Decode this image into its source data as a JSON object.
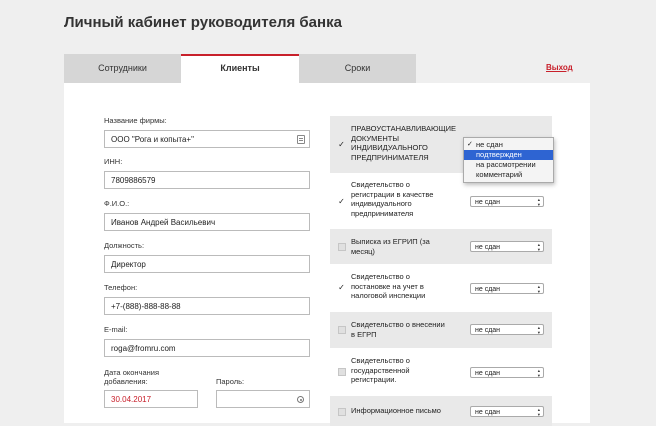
{
  "page": {
    "title": "Личный кабинет руководителя банка"
  },
  "tabs": [
    {
      "label": "Сотрудники",
      "active": false
    },
    {
      "label": "Клиенты",
      "active": true
    },
    {
      "label": "Сроки",
      "active": false
    }
  ],
  "logout_label": "Выход",
  "accent_color": "#c8202b",
  "form": {
    "company": {
      "label": "Название фирмы:",
      "value": "ООО \"Рога и копыта+\""
    },
    "inn": {
      "label": "ИНН:",
      "value": "7809886579"
    },
    "fio": {
      "label": "Ф.И.О.:",
      "value": "Иванов Андрей Васильевич"
    },
    "position": {
      "label": "Должность:",
      "value": "Директор"
    },
    "phone": {
      "label": "Телефон:",
      "value": "+7-(888)-888-88-88"
    },
    "email": {
      "label": "E-mail:",
      "value": "roga@fromru.com"
    },
    "end_date": {
      "label_line1": "Дата окончания",
      "label_line2": "добавления:",
      "value": "30.04.2017"
    },
    "password": {
      "label": "Пароль:",
      "value": ""
    }
  },
  "documents": [
    {
      "lines": [
        "ПРАВОУСТАНАВЛИВАЮЩИЕ",
        "ДОКУМЕНТЫ",
        "ИНДИВИДУАЛЬНОГО",
        "ПРЕДПРИНИМАТЕЛЯ"
      ],
      "checked": true,
      "status": ""
    },
    {
      "lines": [
        "Свидетельство о",
        "регистрации в качестве",
        "индивидуального",
        "предпринимателя"
      ],
      "checked": true,
      "status": "не сдан"
    },
    {
      "lines": [
        "Выписка из ЕГРИП (за",
        "месяц)"
      ],
      "checked": false,
      "status": "не сдан"
    },
    {
      "lines": [
        "Свидетельство о",
        "постановке на учет в",
        "налоговой инспекции"
      ],
      "checked": true,
      "status": "не сдан"
    },
    {
      "lines": [
        "Свидетельство о внесении",
        "в ЕГРП"
      ],
      "checked": false,
      "status": "не сдан"
    },
    {
      "lines": [
        "Свидетельство о",
        "государственной",
        "регистрации."
      ],
      "checked": false,
      "status": "не сдан"
    },
    {
      "lines": [
        "Информационное письмо"
      ],
      "checked": false,
      "status": "не сдан"
    }
  ],
  "dropdown": {
    "options": [
      "не сдан",
      "подтвержден",
      "на рассмотрении",
      "комментарий"
    ],
    "checked_index": 0,
    "highlighted_index": 1
  }
}
